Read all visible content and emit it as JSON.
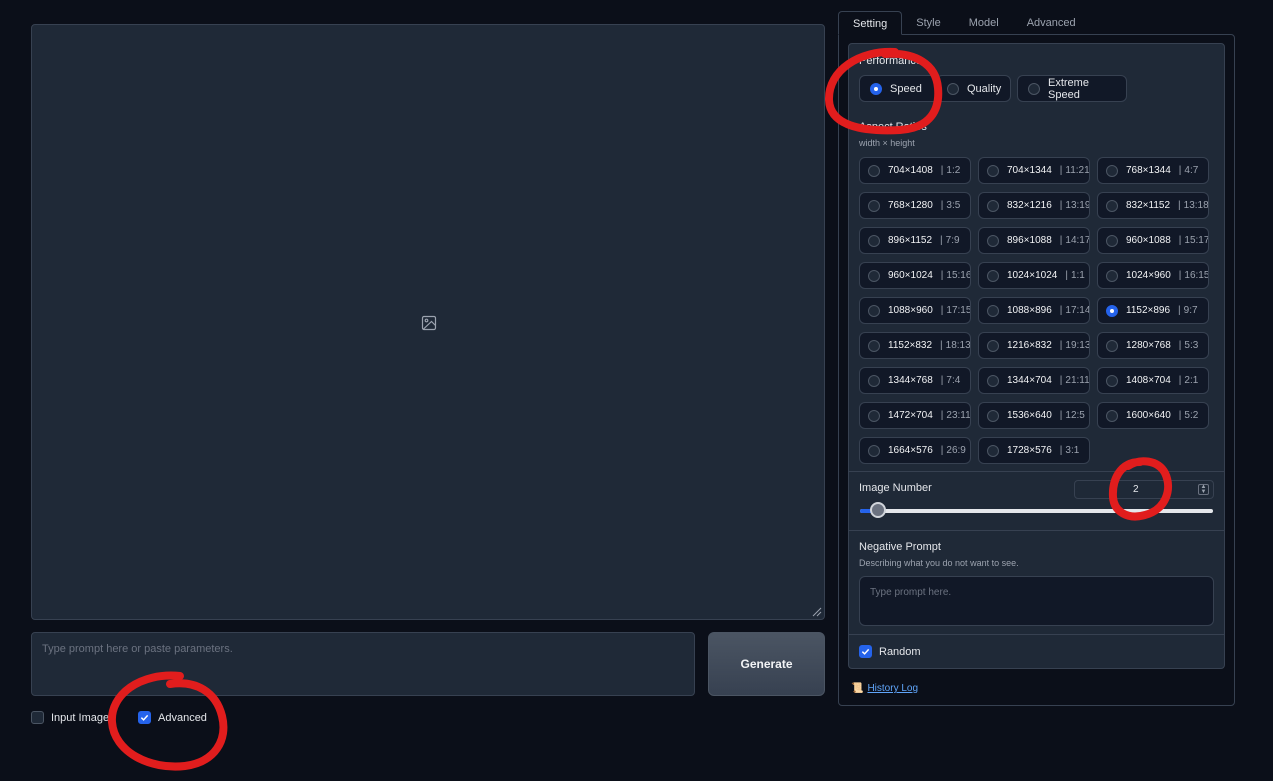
{
  "main": {
    "prompt_placeholder": "Type prompt here or paste parameters.",
    "generate_label": "Generate",
    "input_image_label": "Input Image",
    "input_image_checked": false,
    "advanced_label": "Advanced",
    "advanced_checked": true
  },
  "tabs": [
    {
      "label": "Setting",
      "active": true
    },
    {
      "label": "Style",
      "active": false
    },
    {
      "label": "Model",
      "active": false
    },
    {
      "label": "Advanced",
      "active": false
    }
  ],
  "settings": {
    "performance_label": "Performance",
    "performance_options": [
      {
        "label": "Speed",
        "selected": true
      },
      {
        "label": "Quality",
        "selected": false
      },
      {
        "label": "Extreme Speed",
        "selected": false
      }
    ],
    "aspect_label": "Aspect Ratios",
    "aspect_sublabel": "width × height",
    "aspect_options": [
      {
        "size": "704×1408",
        "ratio": "1:2"
      },
      {
        "size": "704×1344",
        "ratio": "11:21"
      },
      {
        "size": "768×1344",
        "ratio": "4:7"
      },
      {
        "size": "768×1280",
        "ratio": "3:5"
      },
      {
        "size": "832×1216",
        "ratio": "13:19"
      },
      {
        "size": "832×1152",
        "ratio": "13:18"
      },
      {
        "size": "896×1152",
        "ratio": "7:9"
      },
      {
        "size": "896×1088",
        "ratio": "14:17"
      },
      {
        "size": "960×1088",
        "ratio": "15:17"
      },
      {
        "size": "960×1024",
        "ratio": "15:16"
      },
      {
        "size": "1024×1024",
        "ratio": "1:1"
      },
      {
        "size": "1024×960",
        "ratio": "16:15"
      },
      {
        "size": "1088×960",
        "ratio": "17:15"
      },
      {
        "size": "1088×896",
        "ratio": "17:14"
      },
      {
        "size": "1152×896",
        "ratio": "9:7"
      },
      {
        "size": "1152×832",
        "ratio": "18:13"
      },
      {
        "size": "1216×832",
        "ratio": "19:13"
      },
      {
        "size": "1280×768",
        "ratio": "5:3"
      },
      {
        "size": "1344×768",
        "ratio": "7:4"
      },
      {
        "size": "1344×704",
        "ratio": "21:11"
      },
      {
        "size": "1408×704",
        "ratio": "2:1"
      },
      {
        "size": "1472×704",
        "ratio": "23:11"
      },
      {
        "size": "1536×640",
        "ratio": "12:5"
      },
      {
        "size": "1600×640",
        "ratio": "5:2"
      },
      {
        "size": "1664×576",
        "ratio": "26:9"
      },
      {
        "size": "1728×576",
        "ratio": "3:1"
      }
    ],
    "aspect_selected": "1152×896",
    "image_number_label": "Image Number",
    "image_number_value": "2",
    "image_number_slider_fraction": 0.05,
    "negative_prompt_label": "Negative Prompt",
    "negative_prompt_sublabel": "Describing what you do not want to see.",
    "negative_prompt_placeholder": "Type prompt here.",
    "random_label": "Random",
    "random_checked": true
  },
  "history": {
    "icon": "scroll-icon",
    "label": "History Log"
  },
  "colors": {
    "background": "#0b0f19",
    "panel": "#1f2937",
    "accent": "#2563eb",
    "annotation": "#e11d1d"
  }
}
